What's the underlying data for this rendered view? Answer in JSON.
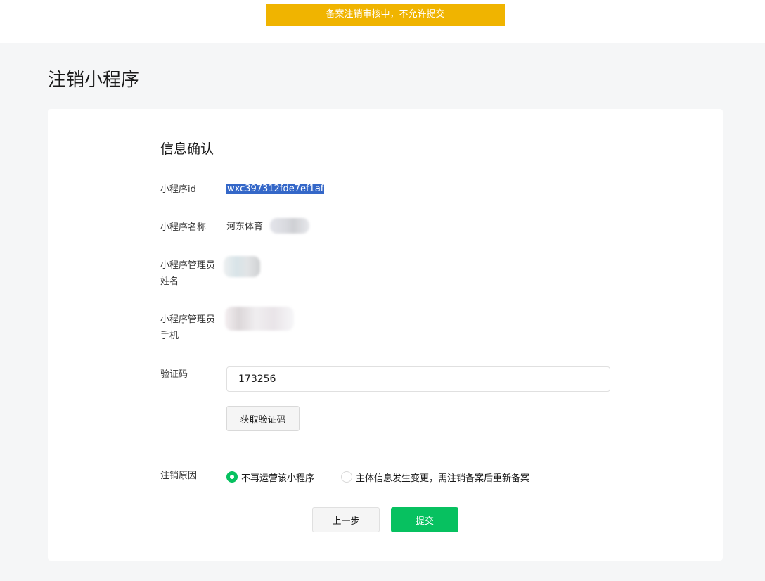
{
  "banner": {
    "text": "备案注销审核中，不允许提交",
    "color": "#f0b400"
  },
  "page": {
    "title": "注销小程序"
  },
  "form": {
    "section_title": "信息确认",
    "fields": {
      "appid": {
        "label": "小程序id",
        "value": "wxc397312fde7ef1af"
      },
      "name": {
        "label": "小程序名称",
        "value": "河东体育"
      },
      "admin_name": {
        "label": "小程序管理员姓名"
      },
      "admin_phone": {
        "label": "小程序管理员手机"
      },
      "verify_code": {
        "label": "验证码",
        "value": "173256"
      }
    },
    "get_code_button": "获取验证码",
    "reason": {
      "label": "注销原因",
      "options": [
        {
          "label": "不再运营该小程序",
          "selected": true
        },
        {
          "label": "主体信息发生变更，需注销备案后重新备案",
          "selected": false
        }
      ]
    },
    "actions": {
      "prev": "上一步",
      "submit": "提交"
    }
  },
  "colors": {
    "accent": "#07c160",
    "selection": "#3467c8"
  }
}
